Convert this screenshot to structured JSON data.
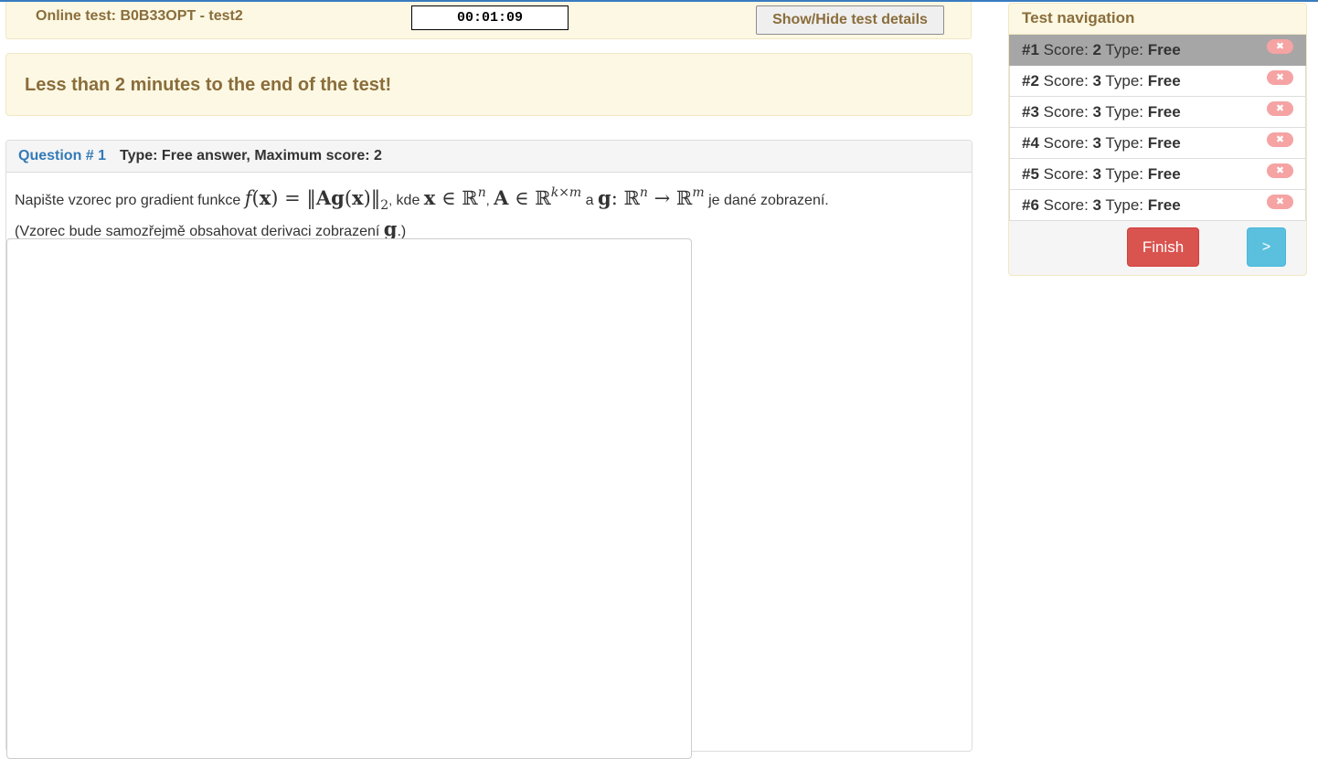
{
  "header": {
    "title": "Online test: B0B33OPT - test2",
    "timer": "00:01:09",
    "details_button": "Show/Hide test details"
  },
  "warning": {
    "text": "Less than 2 minutes to the end of the test!"
  },
  "question": {
    "number_label": "Question # 1",
    "meta": "Type: Free answer, Maximum score: 2",
    "text_parts": {
      "intro": "Napište vzorec pro gradient funkce",
      "kde": "kde",
      "a": "a",
      "end": "je dané zobrazení.",
      "line2_start": "(Vzorec bude samozřejmě obsahovat derivaci zobrazení",
      "line2_end": ".)"
    },
    "answer_value": ""
  },
  "navigation": {
    "title": "Test navigation",
    "items": [
      {
        "id": "#1",
        "score_label": "Score:",
        "score": "2",
        "type_label": "Type:",
        "type": "Free",
        "active": true
      },
      {
        "id": "#2",
        "score_label": "Score:",
        "score": "3",
        "type_label": "Type:",
        "type": "Free",
        "active": false
      },
      {
        "id": "#3",
        "score_label": "Score:",
        "score": "3",
        "type_label": "Type:",
        "type": "Free",
        "active": false
      },
      {
        "id": "#4",
        "score_label": "Score:",
        "score": "3",
        "type_label": "Type:",
        "type": "Free",
        "active": false
      },
      {
        "id": "#5",
        "score_label": "Score:",
        "score": "3",
        "type_label": "Type:",
        "type": "Free",
        "active": false
      },
      {
        "id": "#6",
        "score_label": "Score:",
        "score": "3",
        "type_label": "Type:",
        "type": "Free",
        "active": false
      }
    ],
    "finish_label": "Finish",
    "next_label": ">",
    "remove_icon": "close-icon"
  },
  "colors": {
    "warning_bg": "#fcf8e3",
    "warning_text": "#8a6d3b",
    "link_blue": "#337ab7",
    "finish_red": "#d9534f",
    "next_cyan": "#5bc0de",
    "active_item": "#a6a6a6"
  }
}
